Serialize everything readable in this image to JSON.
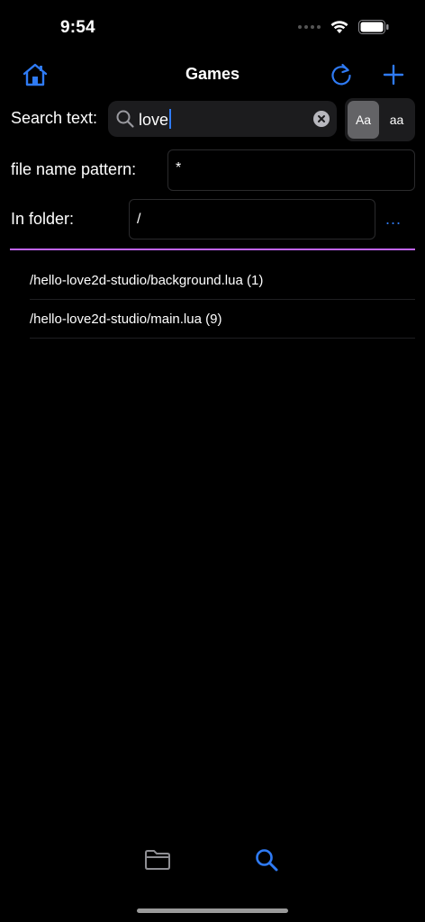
{
  "status_bar": {
    "time": "9:54"
  },
  "nav": {
    "title": "Games",
    "home_icon": "house-icon",
    "refresh_icon": "refresh-icon",
    "add_icon": "plus-icon"
  },
  "search": {
    "label": "Search text:",
    "value": "love",
    "case_options": [
      {
        "label": "Aa",
        "selected": true
      },
      {
        "label": "aa",
        "selected": false
      }
    ]
  },
  "pattern": {
    "label": "file name pattern:",
    "value": "*"
  },
  "folder": {
    "label": "In folder:",
    "value": "/",
    "more_label": "..."
  },
  "results": [
    {
      "text": "/hello-love2d-studio/background.lua (1)"
    },
    {
      "text": "/hello-love2d-studio/main.lua (9)"
    }
  ],
  "tab_bar": {
    "items": [
      {
        "icon": "folder-icon",
        "selected": false
      },
      {
        "icon": "search-icon",
        "selected": true
      }
    ]
  },
  "colors": {
    "accent": "#2f7bf5",
    "divider": "#c264ff",
    "background": "#000000"
  }
}
